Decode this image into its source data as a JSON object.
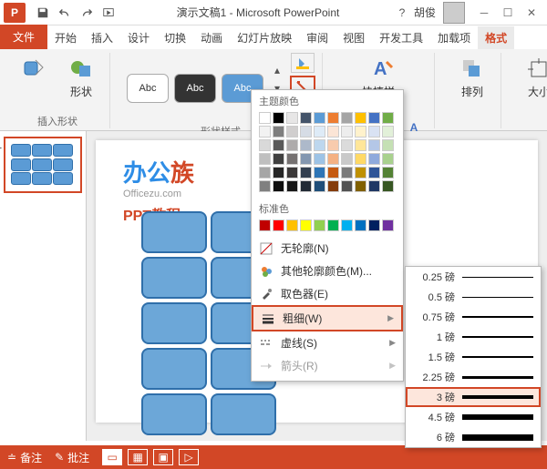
{
  "title": "演示文稿1 - Microsoft PowerPoint",
  "user": "胡俊",
  "tabs": {
    "file": "文件",
    "home": "开始",
    "insert": "插入",
    "design": "设计",
    "transitions": "切换",
    "animations": "动画",
    "slideshow": "幻灯片放映",
    "review": "审阅",
    "view": "视图",
    "developer": "开发工具",
    "addins": "加载项",
    "format": "格式"
  },
  "ribbon": {
    "shapes_label": "形状",
    "insert_shapes": "插入形状",
    "shape_styles": "形状样式",
    "quick_styles": "快捷样式",
    "arrange": "排列",
    "size": "大小",
    "sample_text": "Abc"
  },
  "outline_menu": {
    "theme_colors": "主题颜色",
    "standard_colors": "标准色",
    "no_outline": "无轮廓(N)",
    "more_colors": "其他轮廓颜色(M)...",
    "eyedropper": "取色器(E)",
    "weight": "粗细(W)",
    "dashes": "虚线(S)",
    "arrows": "箭头(R)"
  },
  "weights": [
    {
      "label": "0.25 磅",
      "h": 0.5
    },
    {
      "label": "0.5 磅",
      "h": 1
    },
    {
      "label": "0.75 磅",
      "h": 1.5
    },
    {
      "label": "1 磅",
      "h": 2,
      "hl": false
    },
    {
      "label": "1.5 磅",
      "h": 2.5
    },
    {
      "label": "2.25 磅",
      "h": 3
    },
    {
      "label": "3 磅",
      "h": 4,
      "hl": true
    },
    {
      "label": "4.5 磅",
      "h": 5.5
    },
    {
      "label": "6 磅",
      "h": 7
    }
  ],
  "theme_palette": [
    "#ffffff",
    "#000000",
    "#e7e6e6",
    "#44546a",
    "#5b9bd5",
    "#ed7d31",
    "#a5a5a5",
    "#ffc000",
    "#4472c4",
    "#70ad47",
    "#f2f2f2",
    "#7f7f7f",
    "#d0cece",
    "#d6dce5",
    "#deebf7",
    "#fbe5d6",
    "#ededed",
    "#fff2cc",
    "#d9e2f3",
    "#e2f0d9",
    "#d9d9d9",
    "#595959",
    "#aeabab",
    "#adb9ca",
    "#bdd7ee",
    "#f8cbad",
    "#dbdbdb",
    "#ffe699",
    "#b4c7e7",
    "#c5e0b4",
    "#bfbfbf",
    "#404040",
    "#757171",
    "#8497b0",
    "#9dc3e6",
    "#f4b183",
    "#c9c9c9",
    "#ffd966",
    "#8faadc",
    "#a9d18e",
    "#a6a6a6",
    "#262626",
    "#3b3838",
    "#333f50",
    "#2e75b6",
    "#c55a11",
    "#7b7b7b",
    "#bf9000",
    "#2f5597",
    "#548235",
    "#808080",
    "#0d0d0d",
    "#171717",
    "#222a35",
    "#1f4e79",
    "#843c0c",
    "#525252",
    "#806000",
    "#203864",
    "#385723"
  ],
  "standard_palette": [
    "#c00000",
    "#ff0000",
    "#ffc000",
    "#ffff00",
    "#92d050",
    "#00b050",
    "#00b0f0",
    "#0070c0",
    "#002060",
    "#7030a0"
  ],
  "watermark": {
    "brand_a": "办公",
    "brand_b": "族",
    "domain": "Officezu.com",
    "tutorial": "PPT教程"
  },
  "statusbar": {
    "notes": "备注",
    "comments": "批注"
  }
}
